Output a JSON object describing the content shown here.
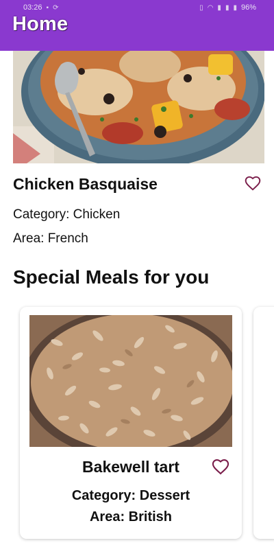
{
  "status_bar": {
    "time": "03:26",
    "battery": "96%"
  },
  "app_bar": {
    "title": "Home",
    "color": "#8a39cf"
  },
  "featured": {
    "name": "Chicken Basquaise",
    "category_label": "Category:",
    "category": "Chicken",
    "area_label": "Area:",
    "area": "French",
    "favorite_icon": "heart-outline-icon",
    "favorite_color": "#7a1d4a"
  },
  "special": {
    "title": "Special Meals for you",
    "meals": [
      {
        "name": "Bakewell tart",
        "category_label": "Category:",
        "category": "Dessert",
        "area_label": "Area:",
        "area": "British",
        "favorite_icon": "heart-outline-icon"
      }
    ]
  }
}
